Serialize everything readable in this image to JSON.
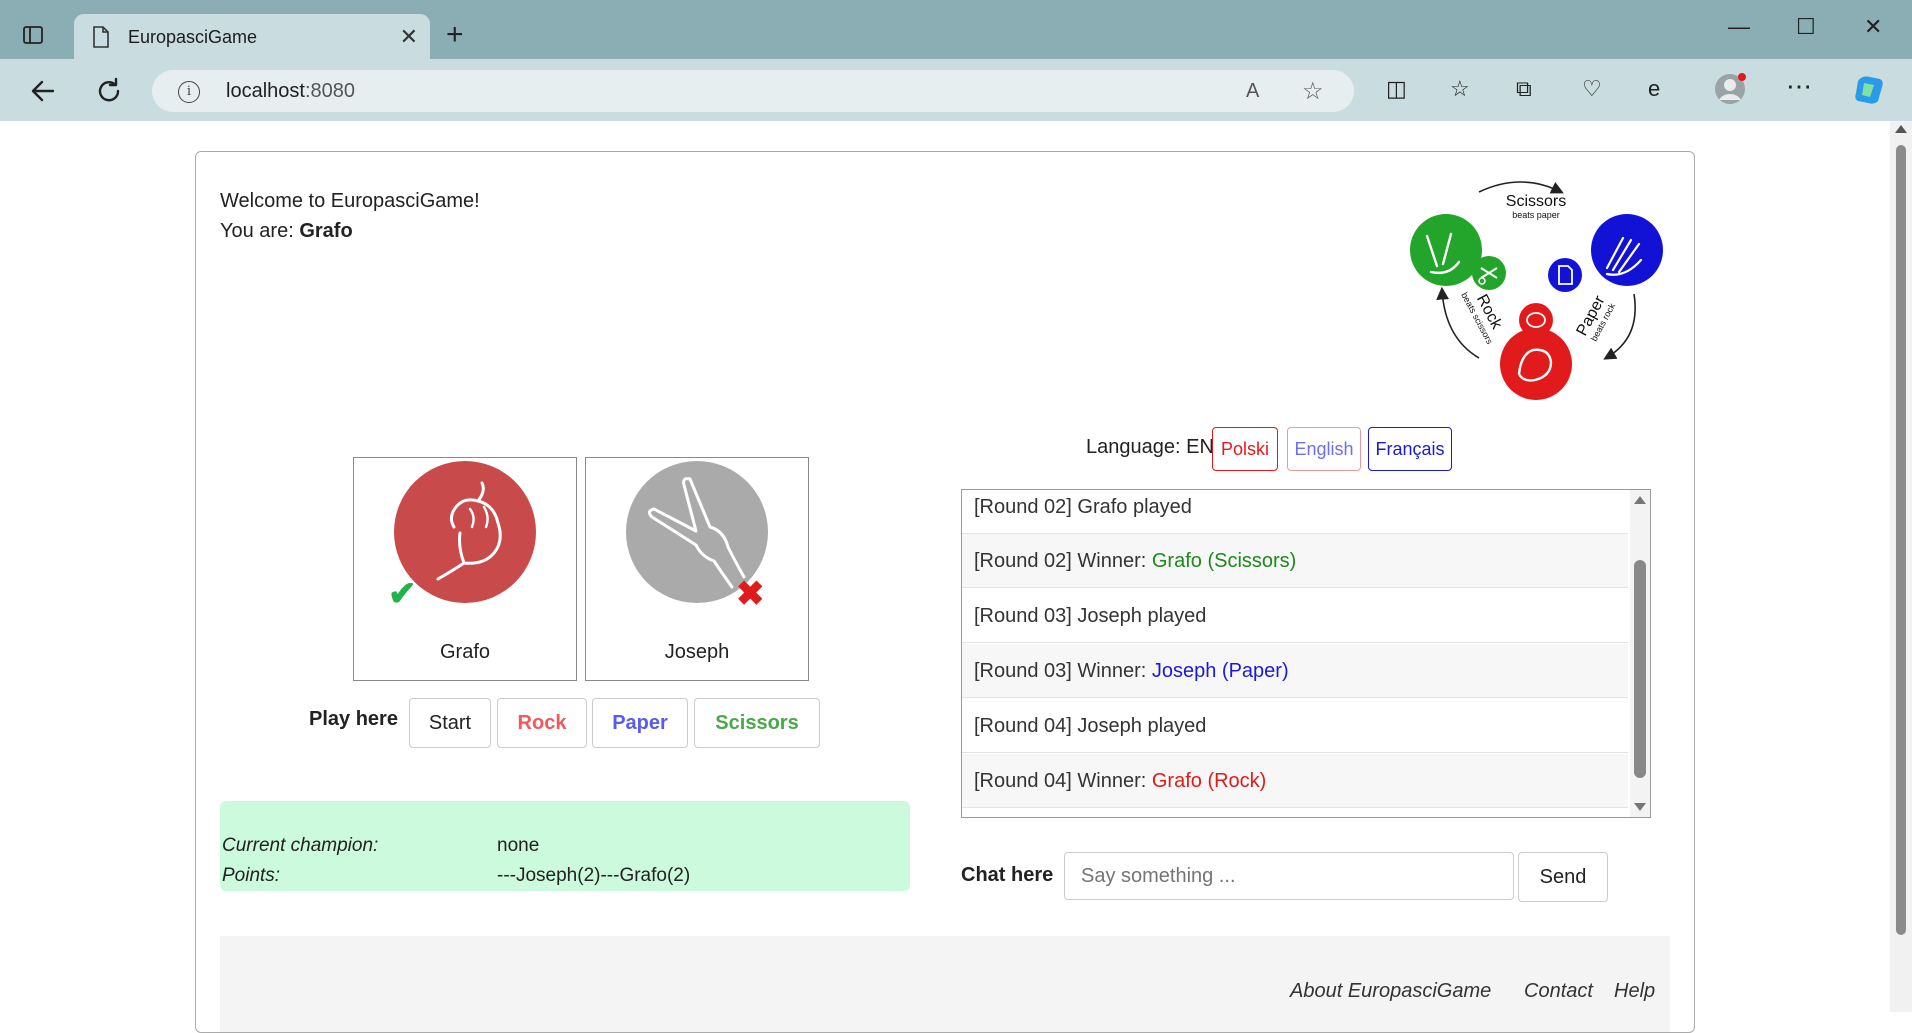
{
  "browser": {
    "tab_title": "EuropasciGame",
    "tab_close": "✕",
    "new_tab": "+",
    "url_host": "localhost",
    "url_port": ":8080",
    "window_controls": {
      "minimize": "—",
      "maximize": "☐",
      "close": "✕"
    }
  },
  "welcome": {
    "line1": "Welcome to EuropasciGame!",
    "line2_prefix": "You are: ",
    "player_name": "Grafo"
  },
  "logo": {
    "scissors": "Scissors",
    "scissors_sub": "beats paper",
    "paper": "Paper",
    "paper_sub": "beats rock",
    "rock": "Rock",
    "rock_sub": "beats scissors",
    "colors": {
      "scissors": "#22a52a",
      "paper": "#1212d6",
      "rock": "#e11b1b"
    }
  },
  "language": {
    "label": "Language: EN",
    "buttons": [
      {
        "label": "Polski",
        "color": "#e01b1b"
      },
      {
        "label": "English",
        "color": "#6e6ef0"
      },
      {
        "label": "Français",
        "color": "#1a1ad8"
      }
    ]
  },
  "players": [
    {
      "name": "Grafo",
      "move": "rock",
      "result": "win",
      "mark": "✔",
      "color": "#c94a4a"
    },
    {
      "name": "Joseph",
      "move": "scissors",
      "result": "lose",
      "mark": "✖",
      "color": "#aaaaaa"
    }
  ],
  "play": {
    "label": "Play here",
    "buttons": [
      {
        "label": "Start",
        "color": "#222222"
      },
      {
        "label": "Rock",
        "color": "#f05a5a"
      },
      {
        "label": "Paper",
        "color": "#5a5af0"
      },
      {
        "label": "Scissors",
        "color": "#4aa84a"
      }
    ]
  },
  "champion": {
    "current_label": "Current champion:",
    "current_value": "none",
    "points_label": "Points:",
    "points_value": "---Joseph(2)---Grafo(2)"
  },
  "log": [
    {
      "prefix": "[Round 02] Grafo played",
      "highlight": "",
      "color": ""
    },
    {
      "prefix": "[Round 02] Winner: ",
      "highlight": "Grafo (Scissors)",
      "color": "#1c8a1c"
    },
    {
      "prefix": "[Round 03] Joseph played",
      "highlight": "",
      "color": ""
    },
    {
      "prefix": "[Round 03] Winner: ",
      "highlight": "Joseph (Paper)",
      "color": "#1a1ad8"
    },
    {
      "prefix": "[Round 04] Joseph played",
      "highlight": "",
      "color": ""
    },
    {
      "prefix": "[Round 04] Winner: ",
      "highlight": "Grafo (Rock)",
      "color": "#e01b1b"
    }
  ],
  "chat": {
    "label": "Chat here",
    "placeholder": "Say something ...",
    "send_label": "Send"
  },
  "footer": {
    "links": [
      "About EuropasciGame",
      "Contact",
      "Help"
    ]
  }
}
